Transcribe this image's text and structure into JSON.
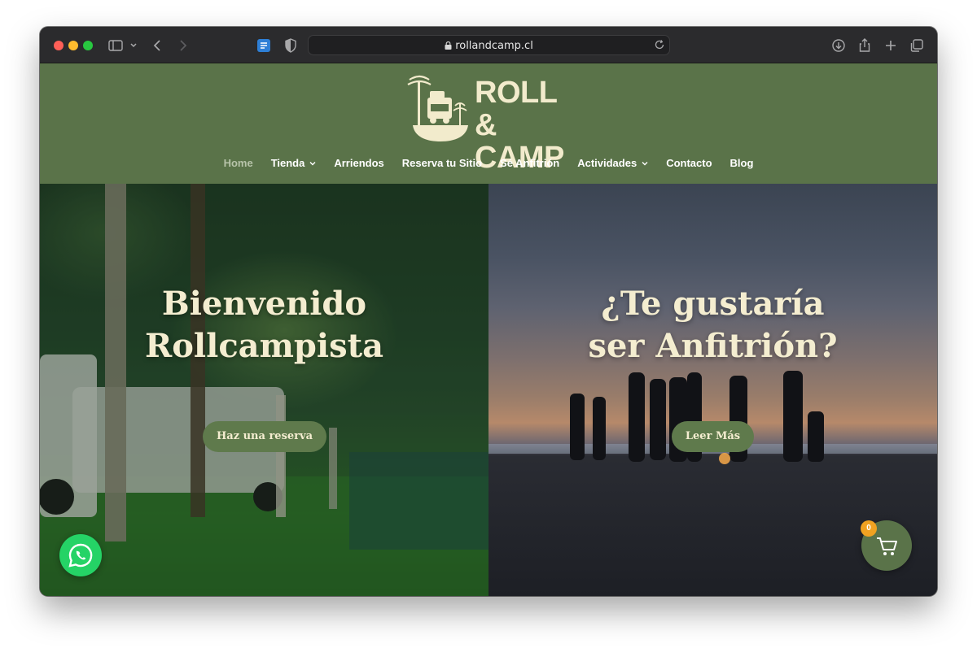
{
  "browser": {
    "url": "rollandcamp.cl"
  },
  "site": {
    "logo_line1": "ROLL &",
    "logo_line2": "CAMP",
    "brand_color": "#5a7349",
    "accent_color": "#f2ebcc"
  },
  "nav": {
    "items": [
      {
        "label": "Home",
        "active": true,
        "dropdown": false
      },
      {
        "label": "Tienda",
        "active": false,
        "dropdown": true
      },
      {
        "label": "Arriendos",
        "active": false,
        "dropdown": false
      },
      {
        "label": "Reserva tu Sitio",
        "active": false,
        "dropdown": false
      },
      {
        "label": "Sé Anfitrión",
        "active": false,
        "dropdown": false
      },
      {
        "label": "Actividades",
        "active": false,
        "dropdown": true
      },
      {
        "label": "Contacto",
        "active": false,
        "dropdown": false
      },
      {
        "label": "Blog",
        "active": false,
        "dropdown": false
      }
    ]
  },
  "hero": {
    "left": {
      "title": "Bienvenido\nRollcampista",
      "button": "Haz una reserva"
    },
    "right": {
      "title": "¿Te gustaría\nser Anfitrión?",
      "button": "Leer Más"
    }
  },
  "widgets": {
    "cart_count": "0",
    "whatsapp_color": "#25d366",
    "badge_color": "#f0a221"
  }
}
